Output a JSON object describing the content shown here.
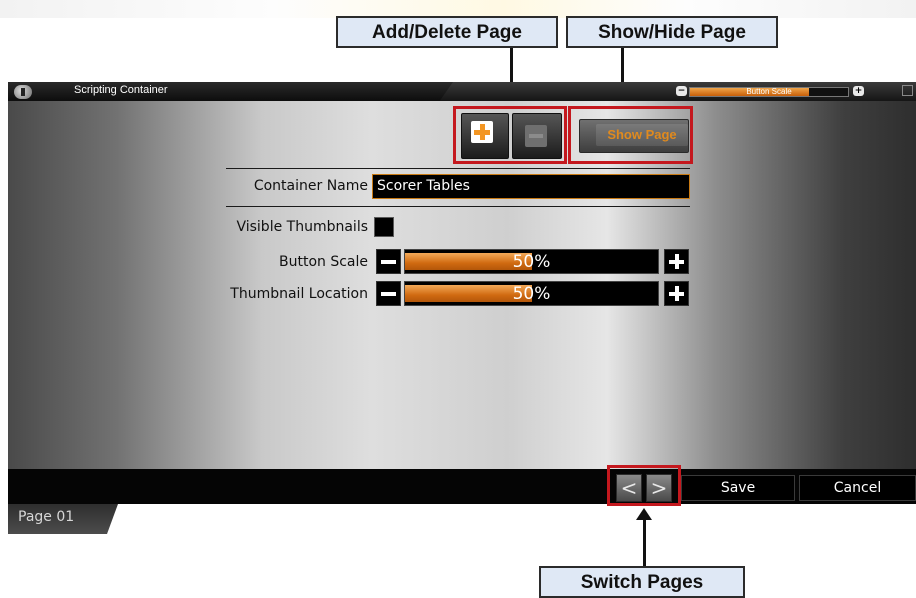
{
  "window": {
    "title": "Scripting Container",
    "toolbar": {
      "minus_icon": "−",
      "plus_icon": "+",
      "scale_label": "Button Scale",
      "scale_value_fraction": 0.75
    }
  },
  "annotations": {
    "add_delete": "Add/Delete Page",
    "show_hide": "Show/Hide Page",
    "switch_pages": "Switch Pages"
  },
  "page_buttons": {
    "add_icon": "plus",
    "delete_icon": "minus",
    "show_page_label": "Show Page"
  },
  "form": {
    "container_name_label": "Container Name",
    "container_name_value": "Scorer Tables",
    "visible_thumbnails_label": "Visible Thumbnails",
    "visible_thumbnails_checked": false,
    "button_scale": {
      "label": "Button Scale",
      "value_text": "50%",
      "value_fraction": 0.5
    },
    "thumbnail_location": {
      "label": "Thumbnail Location",
      "value_text": "50%",
      "value_fraction": 0.5
    }
  },
  "bottom": {
    "prev_glyph": "<",
    "next_glyph": ">",
    "save_label": "Save",
    "cancel_label": "Cancel"
  },
  "page_tab": {
    "label": "Page 01"
  },
  "colors": {
    "accent": "#e07a12",
    "highlight": "#c4181e",
    "callout_bg": "#dfe8f5"
  }
}
